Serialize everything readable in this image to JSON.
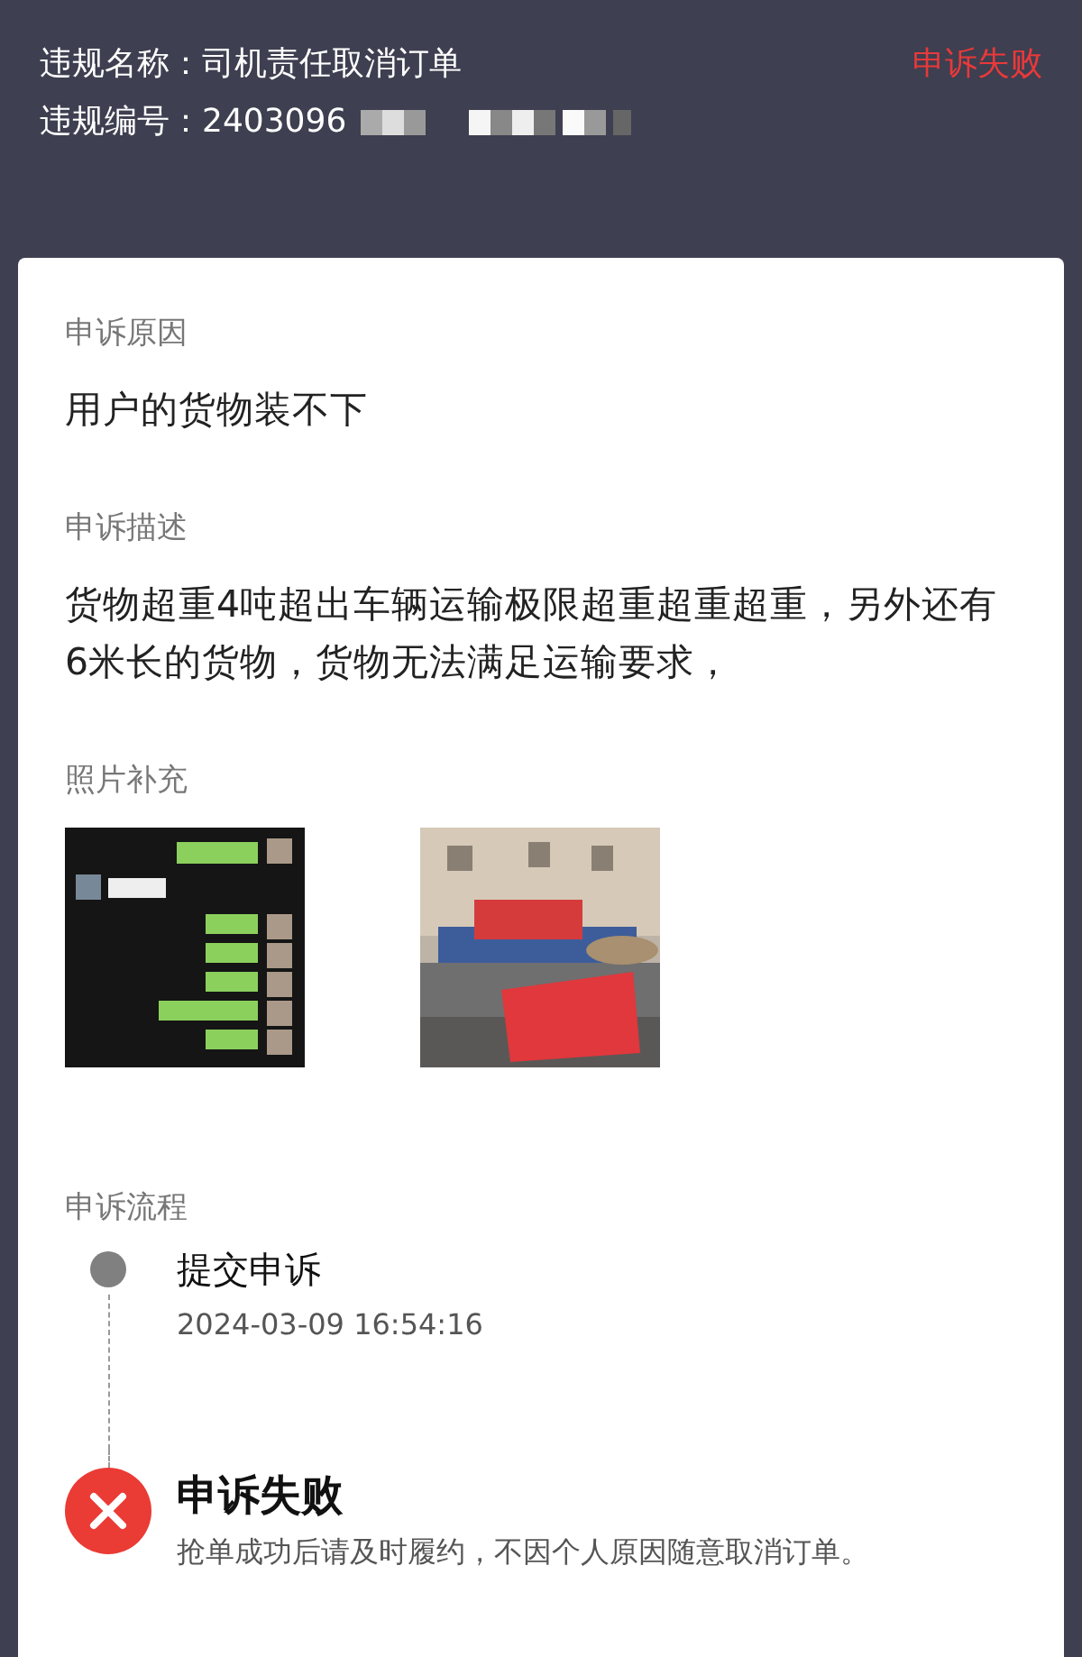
{
  "header": {
    "name_label": "违规名称：",
    "name": "司机责任取消订单",
    "id_label": "违规编号：",
    "id": "2403096",
    "id_redacted": true,
    "status": "申诉失败"
  },
  "sections": [
    {
      "title": "申诉原因",
      "text": "用户的货物装不下"
    },
    {
      "title": "申诉描述",
      "text": "货物超重4吨超出车辆运输极限超重超重超重，另外还有6米长的货物，货物无法满足运输要求，"
    }
  ],
  "photos": {
    "title": "照片补充"
  },
  "process": {
    "title": "申诉流程",
    "steps": [
      {
        "kind": "submitted",
        "title": "提交申诉",
        "detail": "2024-03-09 16:54:16"
      },
      {
        "kind": "failed",
        "title": "申诉失败",
        "detail": "抢单成功后请及时履约，不因个人原因随意取消订单。"
      }
    ]
  }
}
